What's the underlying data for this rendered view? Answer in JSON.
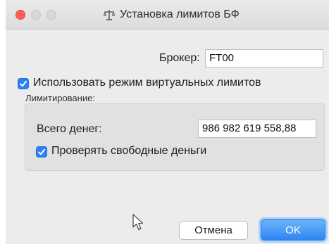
{
  "window": {
    "title": "Установка лимитов БФ"
  },
  "broker": {
    "label": "Брокер:",
    "value": "FT00"
  },
  "virtual_limits": {
    "label": "Использовать режим виртуальных лимитов",
    "checked": true
  },
  "limiting": {
    "section_label": "Лимитирование:"
  },
  "total_money": {
    "label": "Всего денег:",
    "value": "986 982 619 558,88"
  },
  "check_free_money": {
    "label": "Проверять свободные деньги",
    "checked": true
  },
  "buttons": {
    "cancel": "Отмена",
    "ok": "OK"
  },
  "colors": {
    "accent": "#2b80f7",
    "close": "#fc5f57",
    "window_bg": "#ececec"
  },
  "icons": {
    "title": "scales-icon",
    "cursor": "mouse-pointer-icon"
  }
}
